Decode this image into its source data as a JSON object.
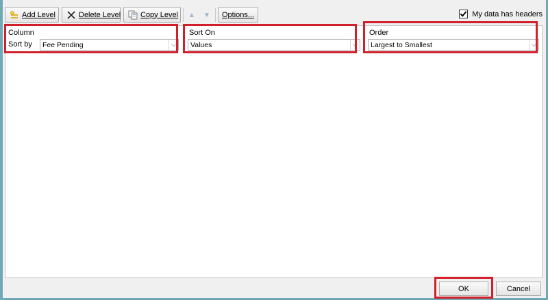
{
  "toolbar": {
    "add_level": "Add Level",
    "delete_level": "Delete Level",
    "copy_level": "Copy Level",
    "options": "Options...",
    "headers_checkbox": "My data has headers",
    "headers_checked": true
  },
  "columns": {
    "column_header": "Column",
    "sort_on_header": "Sort On",
    "order_header": "Order"
  },
  "level": {
    "row_label": "Sort by",
    "column_value": "Fee Pending",
    "sort_on_value": "Values",
    "order_value": "Largest to Smallest"
  },
  "footer": {
    "ok": "OK",
    "cancel": "Cancel"
  },
  "colors": {
    "highlight": "#d11f2b",
    "frame": "#6ea9b5"
  }
}
